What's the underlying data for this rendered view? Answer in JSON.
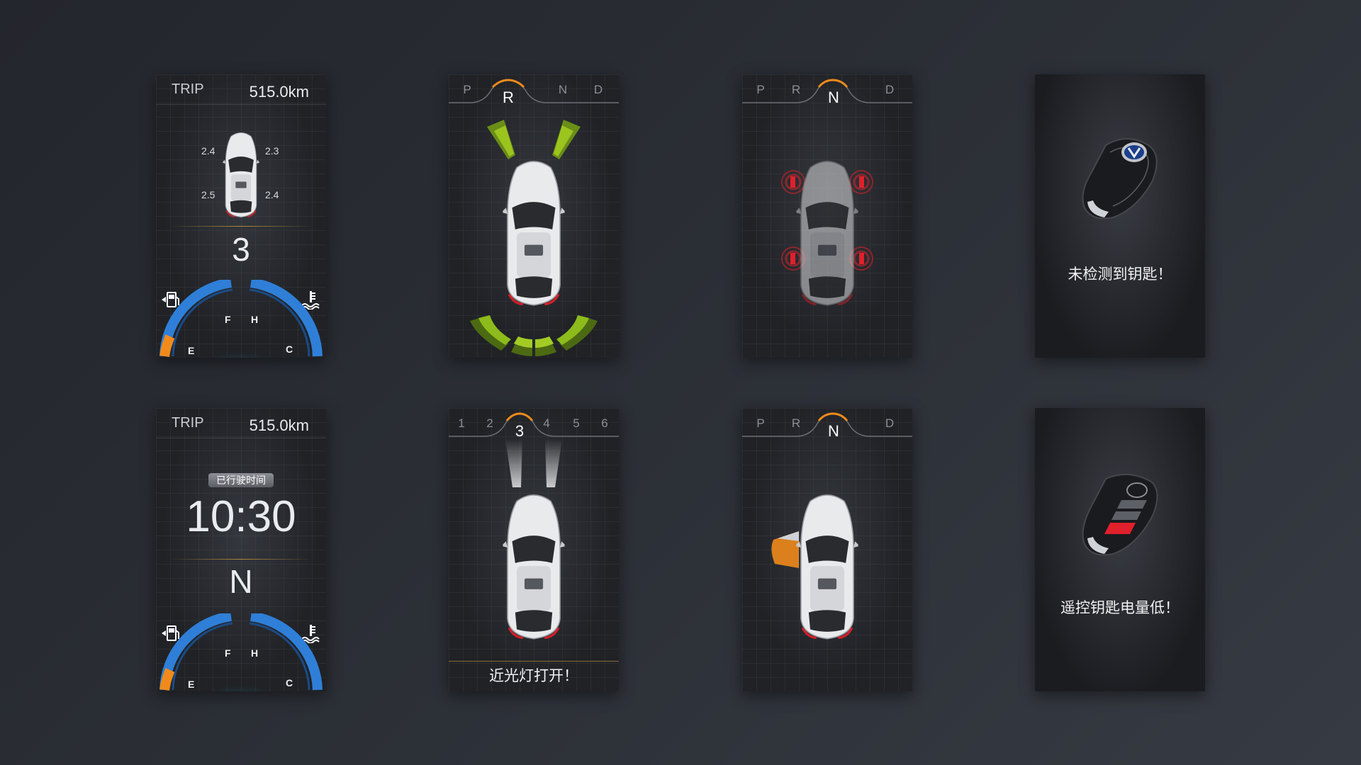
{
  "panels": {
    "trip_tire": {
      "trip_label": "TRIP",
      "trip_value": "515.0km",
      "tire_pressures": {
        "front_left": "2.4",
        "front_right": "2.3",
        "rear_left": "2.5",
        "rear_right": "2.4"
      },
      "gear": "3",
      "gauge": {
        "fuel_full": "F",
        "fuel_empty": "E",
        "temp_hot": "H",
        "temp_cold": "C"
      }
    },
    "reverse_radar": {
      "gears": [
        "P",
        "R",
        "N",
        "D"
      ],
      "active_gear": "R"
    },
    "neutral_sensors": {
      "gears": [
        "P",
        "R",
        "N",
        "D"
      ],
      "active_gear": "N"
    },
    "key_not_detected": {
      "message": "未检测到钥匙！"
    },
    "trip_time": {
      "trip_label": "TRIP",
      "trip_value": "515.0km",
      "badge": "已行驶时间",
      "time": "10:30",
      "gear": "N",
      "gauge": {
        "fuel_full": "F",
        "fuel_empty": "E",
        "temp_hot": "H",
        "temp_cold": "C"
      }
    },
    "low_beam": {
      "gears": [
        "1",
        "2",
        "3",
        "4",
        "5",
        "6"
      ],
      "active_gear": "3",
      "message": "近光灯打开！"
    },
    "door_open": {
      "gears": [
        "P",
        "R",
        "N",
        "D"
      ],
      "active_gear": "N"
    },
    "key_battery_low": {
      "message": "遥控钥匙电量低！"
    }
  },
  "colors": {
    "gauge_blue": "#2f7fd8",
    "warning_orange": "#f08a1c",
    "radar_green": "#8dbb1c",
    "sensor_red": "#e0202a"
  },
  "icons": [
    "fuel-pump-icon",
    "coolant-temp-icon",
    "car-top-view-icon",
    "remote-key-icon"
  ]
}
